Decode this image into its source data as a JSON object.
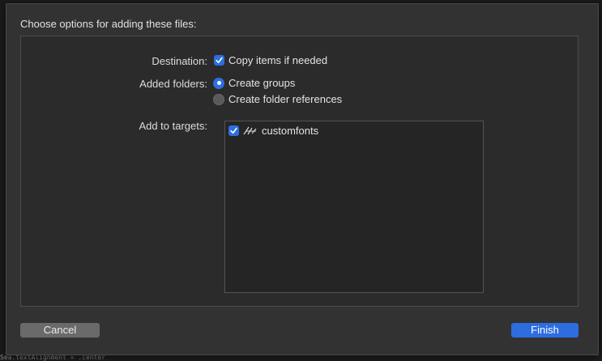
{
  "dialog": {
    "heading": "Choose options for adding these files:",
    "destination": {
      "label": "Destination:",
      "option_label": "Copy items if needed",
      "checked": true
    },
    "added_folders": {
      "label": "Added folders:",
      "options": [
        {
          "label": "Create groups",
          "selected": true
        },
        {
          "label": "Create folder references",
          "selected": false
        }
      ]
    },
    "targets": {
      "label": "Add to targets:",
      "items": [
        {
          "label": "customfonts",
          "checked": true,
          "icon": "app-target-icon"
        }
      ]
    },
    "buttons": {
      "cancel": "Cancel",
      "finish": "Finish"
    }
  },
  "background": {
    "bottom_text": "Sea.textAlignment = .center"
  },
  "colors": {
    "accent": "#2c6fe0",
    "sheet": "#323232",
    "panel": "#2b2b2b"
  }
}
